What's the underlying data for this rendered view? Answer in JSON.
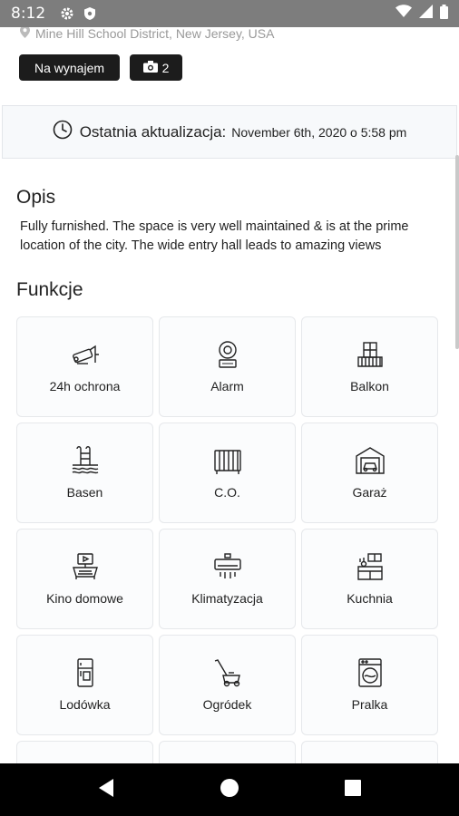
{
  "status_bar": {
    "time": "8:12"
  },
  "address": "Mine Hill School District, New Jersey, USA",
  "badges": {
    "status": "Na wynajem",
    "photo_count": "2"
  },
  "update": {
    "label": "Ostatnia aktualizacja:",
    "value": "November 6th, 2020 o 5:58 pm"
  },
  "description": {
    "title": "Opis",
    "text": "Fully furnished. The space is very well maintained & is at the prime location of the city. The wide entry hall leads to amazing views"
  },
  "features": {
    "title": "Funkcje",
    "items": [
      {
        "label": "24h ochrona",
        "icon": "security-camera-icon"
      },
      {
        "label": "Alarm",
        "icon": "fire-alarm-icon"
      },
      {
        "label": "Balkon",
        "icon": "balcony-icon"
      },
      {
        "label": "Basen",
        "icon": "pool-icon"
      },
      {
        "label": "C.O.",
        "icon": "radiator-icon"
      },
      {
        "label": "Garaż",
        "icon": "garage-icon"
      },
      {
        "label": "Kino domowe",
        "icon": "home-cinema-icon"
      },
      {
        "label": "Klimatyzacja",
        "icon": "air-conditioner-icon"
      },
      {
        "label": "Kuchnia",
        "icon": "kitchen-icon"
      },
      {
        "label": "Lodówka",
        "icon": "fridge-icon"
      },
      {
        "label": "Ogródek",
        "icon": "lawn-mower-icon"
      },
      {
        "label": "Pralka",
        "icon": "washing-machine-icon"
      }
    ]
  }
}
